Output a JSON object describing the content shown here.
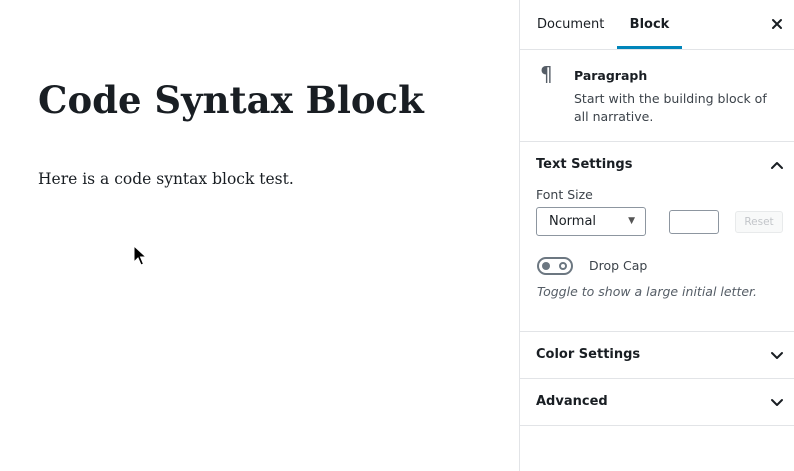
{
  "editor": {
    "title": "Code Syntax Block",
    "paragraph": "Here is a code syntax block test."
  },
  "sidebar": {
    "tabs": [
      "Document",
      "Block"
    ],
    "active_tab": "Block",
    "block": {
      "icon": "paragraph-icon",
      "name": "Paragraph",
      "description": "Start with the building block of all narrative."
    },
    "text_settings": {
      "title": "Text Settings",
      "expanded": true,
      "font_size_label": "Font Size",
      "font_size_value": "Normal",
      "custom_size_value": "",
      "reset_label": "Reset",
      "drop_cap_label": "Drop Cap",
      "drop_cap_enabled": false,
      "drop_cap_help": "Toggle to show a large initial letter."
    },
    "panels": [
      {
        "title": "Color Settings",
        "expanded": false
      },
      {
        "title": "Advanced",
        "expanded": false
      }
    ]
  },
  "colors": {
    "accent": "#0085ba",
    "border": "#e2e4e7",
    "text": "#191e23"
  }
}
